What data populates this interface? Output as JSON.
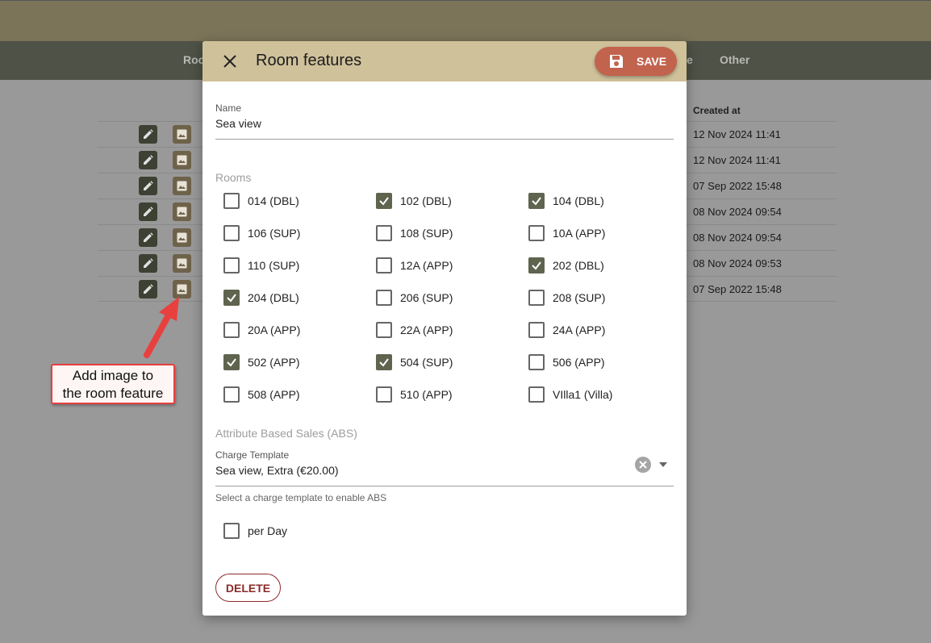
{
  "nav": {
    "left_item": "Roo",
    "right_item_partial": "e",
    "other": "Other"
  },
  "table": {
    "created_header": "Created at",
    "rows": [
      {
        "created": "12 Nov 2024 11:41"
      },
      {
        "created": "12 Nov 2024 11:41"
      },
      {
        "created": "07 Sep 2022 15:48"
      },
      {
        "created": "08 Nov 2024 09:54"
      },
      {
        "created": "08 Nov 2024 09:54"
      },
      {
        "created": "08 Nov 2024 09:53"
      },
      {
        "created": "07 Sep 2022 15:48"
      }
    ]
  },
  "callout": {
    "line1": "Add image to",
    "line2": "the room feature"
  },
  "dialog": {
    "title": "Room features",
    "save_label": "SAVE",
    "name_label": "Name",
    "name_value": "Sea view",
    "rooms_label": "Rooms",
    "rooms": [
      {
        "label": "014 (DBL)",
        "checked": false
      },
      {
        "label": "102 (DBL)",
        "checked": true
      },
      {
        "label": "104 (DBL)",
        "checked": true
      },
      {
        "label": "106 (SUP)",
        "checked": false
      },
      {
        "label": "108 (SUP)",
        "checked": false
      },
      {
        "label": "10A (APP)",
        "checked": false
      },
      {
        "label": "110 (SUP)",
        "checked": false
      },
      {
        "label": "12A (APP)",
        "checked": false
      },
      {
        "label": "202 (DBL)",
        "checked": true
      },
      {
        "label": "204 (DBL)",
        "checked": true
      },
      {
        "label": "206 (SUP)",
        "checked": false
      },
      {
        "label": "208 (SUP)",
        "checked": false
      },
      {
        "label": "20A (APP)",
        "checked": false
      },
      {
        "label": "22A (APP)",
        "checked": false
      },
      {
        "label": "24A (APP)",
        "checked": false
      },
      {
        "label": "502 (APP)",
        "checked": true
      },
      {
        "label": "504 (SUP)",
        "checked": true
      },
      {
        "label": "506 (APP)",
        "checked": false
      },
      {
        "label": "508 (APP)",
        "checked": false
      },
      {
        "label": "510 (APP)",
        "checked": false
      },
      {
        "label": "VIlla1 (Villa)",
        "checked": false
      }
    ],
    "abs_label": "Attribute Based Sales (ABS)",
    "charge_template_label": "Charge Template",
    "charge_template_value": "Sea view, Extra (€20.00)",
    "charge_hint": "Select a charge template to enable ABS",
    "per_day_label": "per Day",
    "per_day_checked": false,
    "delete_label": "DELETE"
  },
  "colors": {
    "accent": "#5e644e",
    "header": "#cfc19a",
    "save": "#c2634e",
    "delete": "#8d2a2a",
    "callout_border": "#e8403f"
  }
}
